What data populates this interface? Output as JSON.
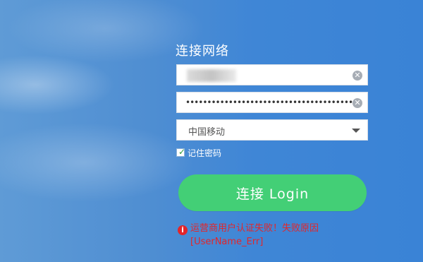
{
  "form": {
    "title": "连接网络",
    "username": {
      "value": "",
      "blurred": true
    },
    "password": {
      "value": "••••••••••••••••••••••••••••••••••••••••••••"
    },
    "carrier": {
      "selected": "中国移动"
    },
    "remember": {
      "label": "记住密码",
      "checked": true
    },
    "login_button": {
      "label": "连接 Login"
    },
    "error": {
      "line1": "运营商用户认证失败！失败原因",
      "line2": "[UserName_Err]"
    },
    "icons": {
      "clear": "clear-icon",
      "dropdown": "chevron-down-icon",
      "alert": "alert-icon",
      "check": "check-icon"
    },
    "colors": {
      "accent": "#43cf76",
      "error": "#e3262a",
      "background": "#3f86d6"
    }
  }
}
